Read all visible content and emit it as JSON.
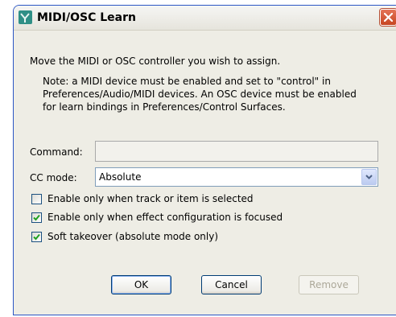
{
  "window": {
    "title": "MIDI/OSC Learn"
  },
  "intro": "Move the MIDI or OSC controller you wish to assign.",
  "note": "Note: a MIDI device must be enabled and set to \"control\" in Preferences/Audio/MIDI devices. An OSC device must be enabled for learn bindings in Preferences/Control Surfaces.",
  "command": {
    "label": "Command:",
    "value": ""
  },
  "cc_mode": {
    "label": "CC mode:",
    "selected": "Absolute"
  },
  "checkboxes": [
    {
      "label": "Enable only when track or item is selected",
      "checked": false
    },
    {
      "label": "Enable only when effect configuration is focused",
      "checked": true
    },
    {
      "label": "Soft takeover (absolute mode only)",
      "checked": true
    }
  ],
  "buttons": {
    "ok": "OK",
    "cancel": "Cancel",
    "remove": "Remove"
  },
  "colors": {
    "titlebar_border": "#2b56c4",
    "close_button": "#d3532e",
    "dialog_bg": "#eeede5"
  }
}
